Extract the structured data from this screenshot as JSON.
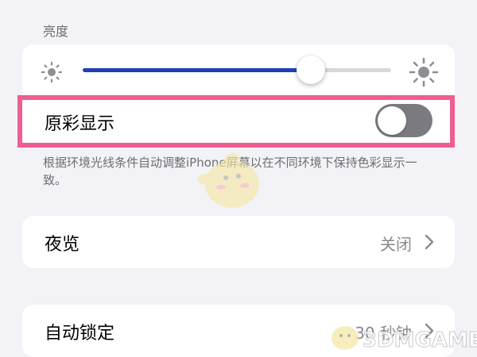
{
  "brightness": {
    "header": "亮度",
    "level": 0.74,
    "min_icon": "sun-small-icon",
    "max_icon": "sun-large-icon"
  },
  "true_tone": {
    "label": "原彩显示",
    "enabled": false,
    "footer": "根据环境光线条件自动调整iPhone屏幕以在不同环境下保持色彩显示一致。"
  },
  "night_shift": {
    "label": "夜览",
    "value": "关闭"
  },
  "auto_lock": {
    "label": "自动锁定",
    "value": "30 秒钟"
  },
  "watermark": {
    "text": "3DMGAME"
  },
  "colors": {
    "background": "#f2f2f7",
    "slider_fill": "#1f3fb4",
    "toggle_off": "#7a7a80",
    "highlight": "#ee5e92",
    "secondary_text": "#6d6d72"
  }
}
